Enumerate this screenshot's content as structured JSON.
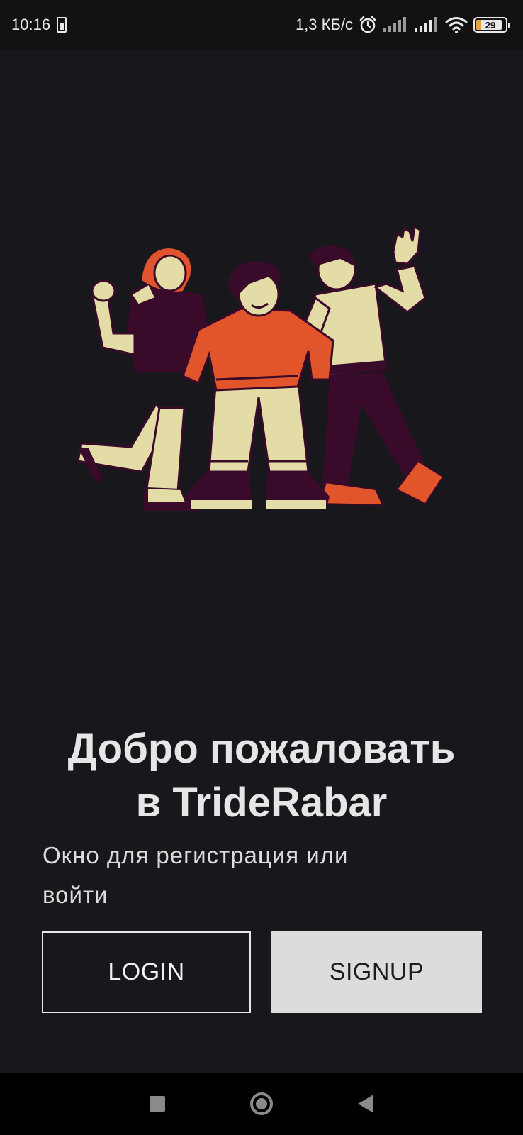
{
  "status_bar": {
    "time": "10:16",
    "network_speed": "1,3 КБ/с",
    "battery_level": "29",
    "icons": [
      "sim-icon",
      "alarm-icon",
      "signal-icon",
      "signal-icon",
      "wifi-icon",
      "battery-icon"
    ]
  },
  "illustration": {
    "description_icon": "three-friends-illustration",
    "colors": {
      "cream": "#e3dca6",
      "dark_purple": "#3a0a2a",
      "orange": "#e2552b",
      "red_hair": "#e0532e"
    }
  },
  "welcome": {
    "title_line1": "Добро пожаловать",
    "title_line2": "в TrideRabar",
    "subtitle_line1": "Окно для регистрация или",
    "subtitle_line2": "войти"
  },
  "buttons": {
    "login_label": "LOGIN",
    "signup_label": "SIGNUP"
  },
  "colors": {
    "background": "#18171c",
    "status_bar": "#121114",
    "signup_bg": "#dcdcdc"
  },
  "nav_bar": {
    "icons": [
      "recent-apps-icon",
      "home-icon",
      "back-icon"
    ]
  }
}
